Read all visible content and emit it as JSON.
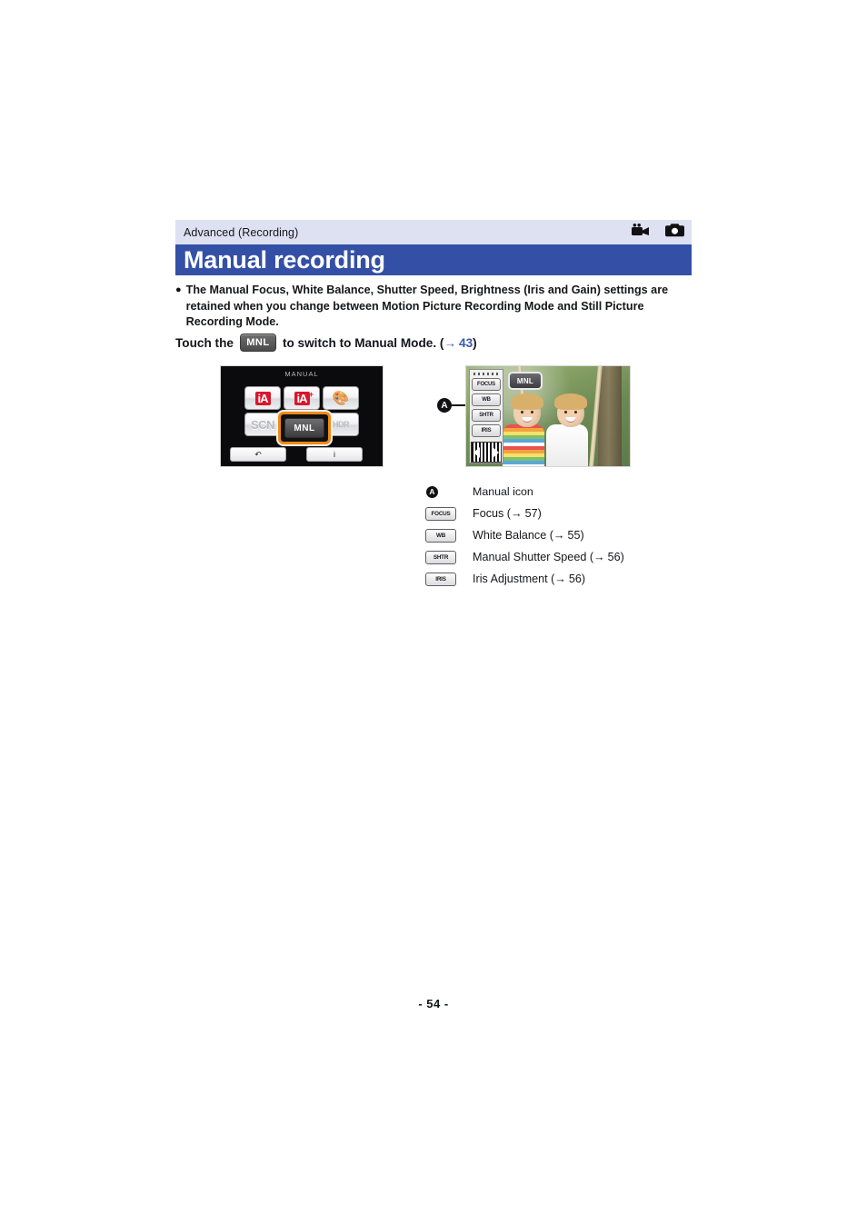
{
  "header": {
    "breadcrumb": "Advanced (Recording)",
    "title": "Manual recording",
    "icons": [
      {
        "name": "movie-camera-icon",
        "label": "Motion Picture Recording Mode"
      },
      {
        "name": "still-camera-icon",
        "label": "Still Picture Recording Mode"
      }
    ],
    "strip_color": "#dde1f2",
    "title_bar_color": "#3450a6"
  },
  "bullet": {
    "marker": "●",
    "text": "The Manual Focus, White Balance, Shutter Speed, Brightness (Iris and Gain) settings are retained when you change between Motion Picture Recording Mode and Still Picture Recording Mode."
  },
  "instruction": {
    "before": "Touch the",
    "chip": "MNL",
    "after": "to switch to Manual Mode. (",
    "arrow": "→",
    "page_ref": "43",
    "close": ")"
  },
  "screenshot_left": {
    "label": "MANUAL",
    "buttons": [
      {
        "name": "ia-mode-button",
        "label": "iA"
      },
      {
        "name": "ia-plus-mode-button",
        "label": "iA",
        "sup": "+"
      },
      {
        "name": "creative-control-button",
        "label": "🎨"
      },
      {
        "name": "scene-mode-button",
        "label": "SCN"
      },
      {
        "name": "manual-mode-button",
        "label": "MNL",
        "selected": true
      },
      {
        "name": "hdr-mode-button",
        "label": "HDR"
      }
    ],
    "bottom_buttons": [
      {
        "name": "back-button",
        "label": "↶"
      },
      {
        "name": "info-button",
        "label": "i"
      }
    ],
    "selection_color": "#f08a16"
  },
  "screenshot_right": {
    "osd_badge": "MNL",
    "panel_buttons": [
      {
        "name": "focus-button",
        "label": "FOCUS"
      },
      {
        "name": "white-balance-button",
        "label": "WB"
      },
      {
        "name": "shutter-button",
        "label": "SHTR"
      },
      {
        "name": "iris-button",
        "label": "IRIS"
      }
    ],
    "callout": "A"
  },
  "legend": [
    {
      "key_type": "circle",
      "key": "A",
      "key_name": "callout-a-marker",
      "label": "Manual icon",
      "arrow": "",
      "page": "",
      "close": ""
    },
    {
      "key_type": "chip",
      "key": "FOCUS",
      "key_name": "focus-icon",
      "label": "Focus (",
      "arrow": "→",
      "page": "57",
      "close": ")"
    },
    {
      "key_type": "chip",
      "key": "WB",
      "key_name": "white-balance-icon",
      "label": "White Balance (",
      "arrow": "→",
      "page": "55",
      "close": ")"
    },
    {
      "key_type": "chip",
      "key": "SHTR",
      "key_name": "shutter-icon",
      "label": "Manual Shutter Speed (",
      "arrow": "→",
      "page": "56",
      "close": ")"
    },
    {
      "key_type": "chip",
      "key": "IRIS",
      "key_name": "iris-icon",
      "label": "Iris Adjustment (",
      "arrow": "→",
      "page": "56",
      "close": ")"
    }
  ],
  "footer": {
    "page_number": "- 54 -"
  },
  "colors": {
    "link": "#3a56ab",
    "accent_blue": "#3450a6",
    "selection_orange": "#f08a16"
  }
}
